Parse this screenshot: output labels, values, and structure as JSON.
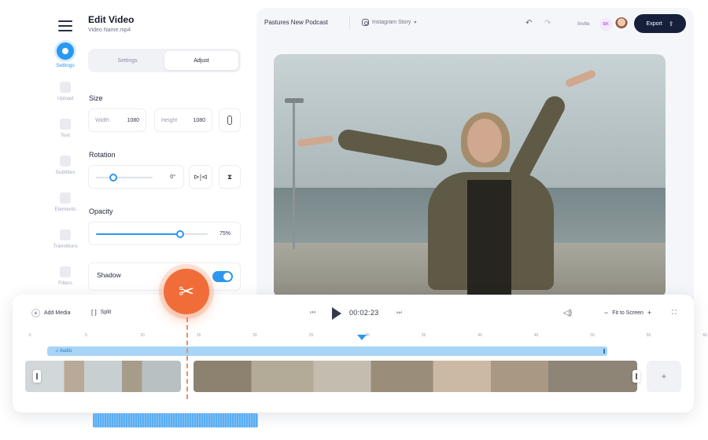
{
  "sidebar": {
    "items": [
      {
        "label": "Settings",
        "icon": "settings-icon",
        "active": true
      },
      {
        "label": "Upload",
        "icon": "upload-icon",
        "active": false
      },
      {
        "label": "Text",
        "icon": "text-icon",
        "active": false
      },
      {
        "label": "Subtitles",
        "icon": "subtitles-icon",
        "active": false
      },
      {
        "label": "Elements",
        "icon": "elements-icon",
        "active": false
      },
      {
        "label": "Transitions",
        "icon": "transitions-icon",
        "active": false
      },
      {
        "label": "Filters",
        "icon": "filters-icon",
        "active": false
      }
    ]
  },
  "panel": {
    "title": "Edit Video",
    "subtitle": "Video Name.mp4",
    "tabs": [
      "Settings",
      "Adjust"
    ],
    "active_tab": "Adjust",
    "size": {
      "title": "Size",
      "width_label": "Width",
      "width_value": "1080",
      "height_label": "Height",
      "height_value": "1080"
    },
    "rotation": {
      "title": "Rotation",
      "value": "0°",
      "level": 0.3
    },
    "opacity": {
      "title": "Opacity",
      "value": "75%",
      "level": 0.75
    },
    "shadow": {
      "title": "Shadow",
      "enabled": true
    }
  },
  "header": {
    "project_name": "Pastures New Podcast",
    "format": "Instagram Story",
    "invite": "Invite",
    "collaborator_initials": "SK",
    "export_label": "Export"
  },
  "timeline": {
    "add_media": "Add Media",
    "split": "Split",
    "time": "00:02:23",
    "fit_label": "Fit to Screen",
    "ruler": [
      "0",
      "5",
      "10",
      "15",
      "20",
      "25",
      "30",
      "35",
      "40",
      "45",
      "50",
      "55",
      "60"
    ],
    "audio_label": "♫ Audio",
    "add_clip": "+"
  },
  "colors": {
    "accent": "#2b98f0",
    "cut": "#f06d3a",
    "dark": "#16203a"
  }
}
